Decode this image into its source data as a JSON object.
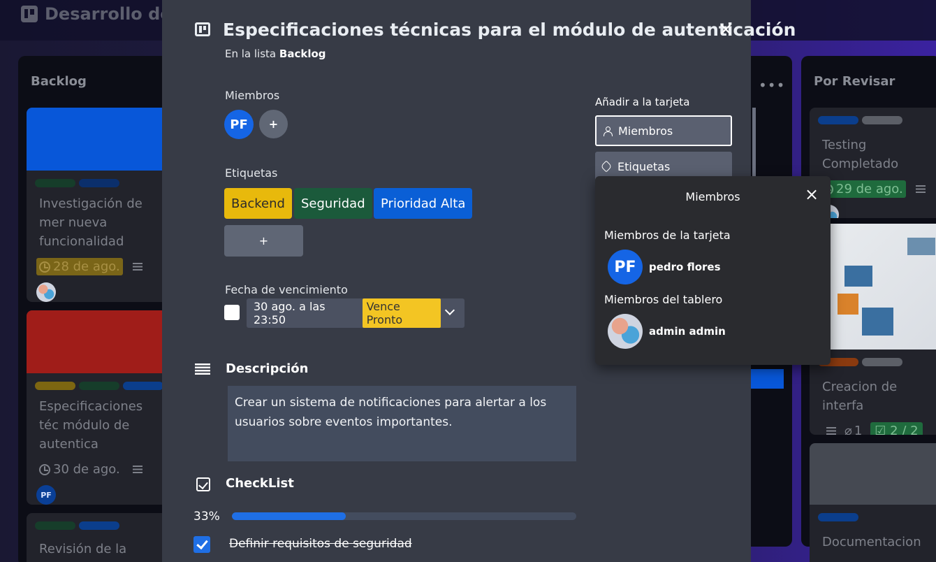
{
  "board": {
    "title": "Desarrollo de"
  },
  "lists": {
    "backlog": {
      "title": "Backlog",
      "cards": [
        {
          "text": "Investigación de mer nueva funcionalidad",
          "due": "28 de ago."
        },
        {
          "text": "Especificaciones téc módulo de autentica",
          "due": "30 de ago.",
          "avatar": "PF"
        },
        {
          "text": "Revisión de la interfa"
        }
      ]
    },
    "review": {
      "title": "Por Revisar",
      "cards": [
        {
          "text": "Testing Completado",
          "due": "29 de ago."
        },
        {
          "text": "Creacion de interfa",
          "attachments": "1",
          "checklist": "2 / 2"
        },
        {
          "text": "Documentacion"
        }
      ]
    }
  },
  "modal": {
    "title": "Especificaciones técnicas para el módulo de autenticación",
    "close": "×",
    "in_list_prefix": "En la lista",
    "list_name": "Backlog",
    "members_label": "Miembros",
    "member_avatar": "PF",
    "add_member": "+",
    "labels_label": "Etiquetas",
    "labels": [
      {
        "name": "Backend",
        "bg": "#e8b90c",
        "fg": "#2b2b2b"
      },
      {
        "name": "Seguridad",
        "bg": "#1b5a3b",
        "fg": "#ffffff"
      },
      {
        "name": "Prioridad Alta",
        "bg": "#0a5fd6",
        "fg": "#ffffff"
      }
    ],
    "add_label": "+",
    "due_label": "Fecha de vencimiento",
    "due_value": "30 ago. a las 23:50",
    "due_badge": "Vence Pronto",
    "description_label": "Descripción",
    "description": "Crear un sistema de notificaciones para alertar a los usuarios sobre eventos importantes.",
    "checklist_label": "CheckList",
    "progress_text": "33%",
    "progress": 0.33,
    "checklist_items": [
      {
        "text": "Definir requisitos de seguridad",
        "done": true
      }
    ],
    "add_to_card": "Añadir a la tarjeta",
    "side_members": "Miembros",
    "side_labels": "Etiquetas"
  },
  "popover": {
    "title": "Miembros",
    "close": "×",
    "card_members_label": "Miembros de la tarjeta",
    "card_member": {
      "initials": "PF",
      "name": "pedro flores"
    },
    "board_members_label": "Miembros del tablero",
    "board_member": {
      "name": "admin admin"
    }
  },
  "colors": {
    "accent": "#1f6fe5",
    "warning": "#f3c523"
  }
}
